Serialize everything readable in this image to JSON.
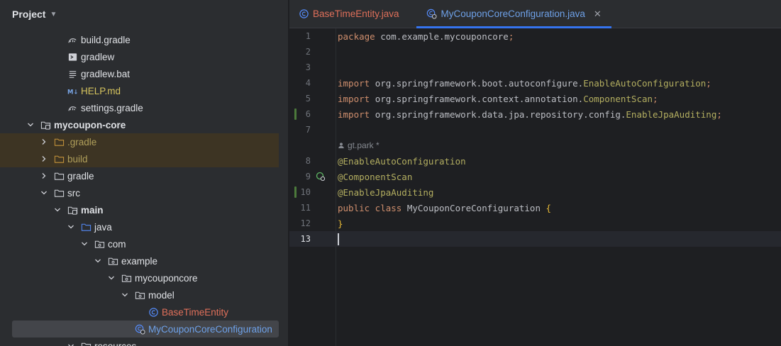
{
  "project_panel": {
    "title": "Project",
    "tree": [
      {
        "label": "build.gradle",
        "icon": "gradle-icon",
        "style": "",
        "depth": 4,
        "arrow": "none"
      },
      {
        "label": "gradlew",
        "icon": "terminal-file-icon",
        "style": "",
        "depth": 4,
        "arrow": "none"
      },
      {
        "label": "gradlew.bat",
        "icon": "text-file-icon",
        "style": "",
        "depth": 4,
        "arrow": "none"
      },
      {
        "label": "HELP.md",
        "icon": "markdown-icon",
        "style": "gitadd",
        "depth": 4,
        "arrow": "none"
      },
      {
        "label": "settings.gradle",
        "icon": "gradle-icon",
        "style": "",
        "depth": 4,
        "arrow": "none"
      },
      {
        "label": "mycoupon-core",
        "icon": "module-folder-icon",
        "style": "bold",
        "depth": 2,
        "arrow": "open"
      },
      {
        "label": ".gradle",
        "icon": "folder-icon-excluded",
        "style": "ignored",
        "depth": 3,
        "arrow": "closed",
        "highlight": true
      },
      {
        "label": "build",
        "icon": "folder-icon-excluded",
        "style": "ignored",
        "depth": 3,
        "arrow": "closed",
        "highlight": true
      },
      {
        "label": "gradle",
        "icon": "folder-icon",
        "style": "",
        "depth": 3,
        "arrow": "closed"
      },
      {
        "label": "src",
        "icon": "folder-icon",
        "style": "",
        "depth": 3,
        "arrow": "open"
      },
      {
        "label": "main",
        "icon": "module-folder-icon",
        "style": "bold",
        "depth": 4,
        "arrow": "open"
      },
      {
        "label": "java",
        "icon": "source-folder-icon",
        "style": "",
        "depth": 5,
        "arrow": "open"
      },
      {
        "label": "com",
        "icon": "package-icon",
        "style": "",
        "depth": 6,
        "arrow": "open"
      },
      {
        "label": "example",
        "icon": "package-icon",
        "style": "",
        "depth": 7,
        "arrow": "open"
      },
      {
        "label": "mycouponcore",
        "icon": "package-icon",
        "style": "",
        "depth": 8,
        "arrow": "open"
      },
      {
        "label": "model",
        "icon": "package-icon",
        "style": "",
        "depth": 9,
        "arrow": "open"
      },
      {
        "label": "BaseTimeEntity",
        "icon": "java-class-icon",
        "style": "modified",
        "depth": 10,
        "arrow": "none"
      },
      {
        "label": "MyCouponCoreConfiguration",
        "icon": "java-class-icon-config",
        "style": "changed",
        "depth": 9,
        "arrow": "none",
        "selected": true
      },
      {
        "label": "resources",
        "icon": "folder-icon",
        "style": "",
        "depth": 5,
        "arrow": "open"
      }
    ]
  },
  "tabs": [
    {
      "label": "BaseTimeEntity.java",
      "active": false
    },
    {
      "label": "MyCouponCoreConfiguration.java",
      "active": true
    }
  ],
  "editor": {
    "author_hint": "gt.park *",
    "lines": [
      {
        "num": "1",
        "tokens": [
          [
            "kw",
            "package "
          ],
          [
            "pkg",
            "com.example.mycouponcore"
          ],
          [
            "semi",
            ";"
          ]
        ]
      },
      {
        "num": "2",
        "tokens": []
      },
      {
        "num": "3",
        "tokens": []
      },
      {
        "num": "4",
        "tokens": [
          [
            "kw",
            "import "
          ],
          [
            "pkg",
            "org.springframework.boot.autoconfigure."
          ],
          [
            "sym",
            "EnableAutoConfiguration"
          ],
          [
            "semi",
            ";"
          ]
        ]
      },
      {
        "num": "5",
        "tokens": [
          [
            "kw",
            "import "
          ],
          [
            "pkg",
            "org.springframework.context.annotation."
          ],
          [
            "sym",
            "ComponentScan"
          ],
          [
            "semi",
            ";"
          ]
        ]
      },
      {
        "num": "6",
        "tokens": [
          [
            "kw",
            "import "
          ],
          [
            "pkg",
            "org.springframework.data.jpa.repository.config."
          ],
          [
            "sym",
            "EnableJpaAuditing"
          ],
          [
            "semi",
            ";"
          ]
        ],
        "modified": true
      },
      {
        "num": "7",
        "tokens": []
      },
      {
        "num": "",
        "hint": true
      },
      {
        "num": "8",
        "tokens": [
          [
            "ann",
            "@EnableAutoConfiguration"
          ]
        ]
      },
      {
        "num": "9",
        "tokens": [
          [
            "ann",
            "@ComponentScan"
          ]
        ],
        "run": true
      },
      {
        "num": "10",
        "tokens": [
          [
            "ann",
            "@EnableJpaAuditing"
          ]
        ],
        "modified": true
      },
      {
        "num": "11",
        "tokens": [
          [
            "kw",
            "public class "
          ],
          [
            "cls",
            "MyCouponCoreConfiguration "
          ],
          [
            "brace",
            "{"
          ]
        ]
      },
      {
        "num": "12",
        "tokens": [
          [
            "brace",
            "}"
          ]
        ]
      },
      {
        "num": "13",
        "tokens": [],
        "current": true
      }
    ]
  },
  "colors": {
    "accent": "#3574f0",
    "modified_text": "#e0705a",
    "changed_text": "#6ea1e8",
    "ignored_text": "#b09f5a"
  }
}
